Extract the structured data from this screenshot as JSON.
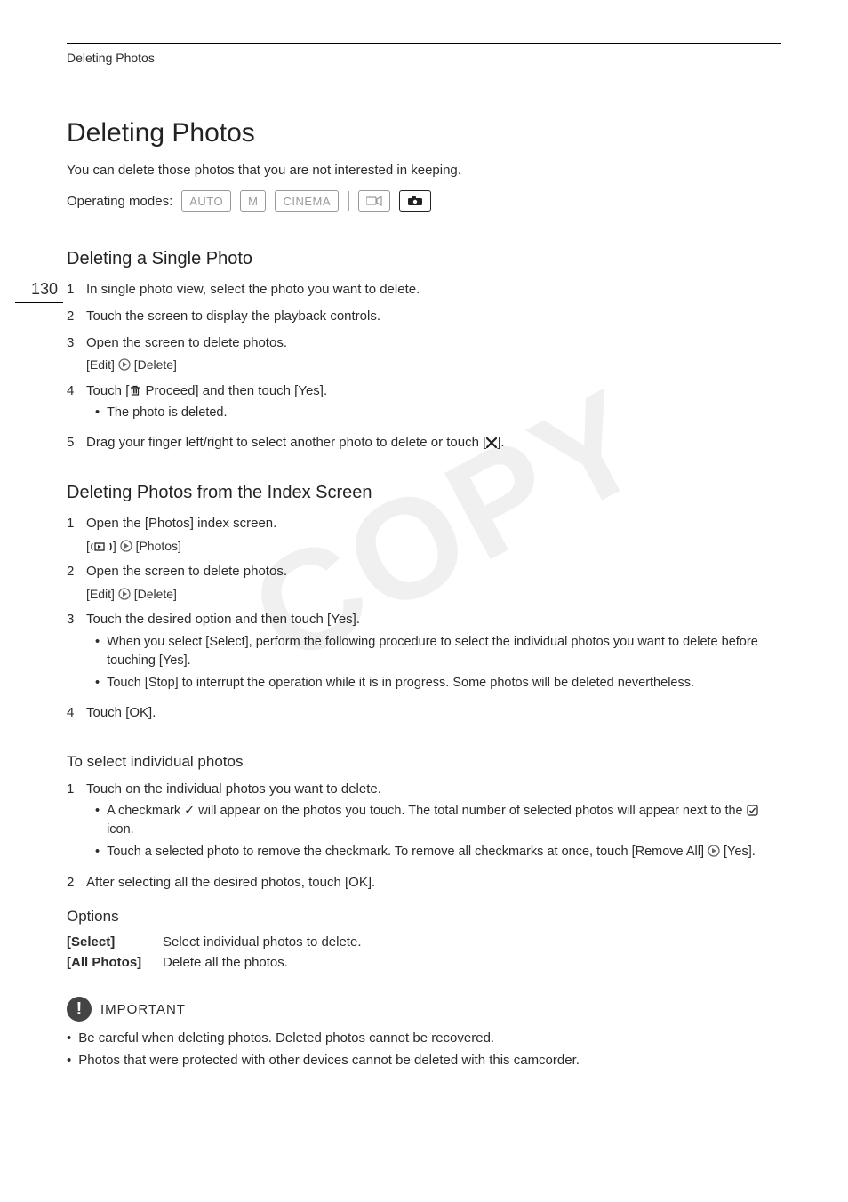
{
  "pageNumber": "130",
  "headerSmall": "Deleting Photos",
  "h1": "Deleting Photos",
  "intro": "You can delete those photos that you are not interested in keeping.",
  "modes": {
    "label": "Operating modes:",
    "items": [
      "AUTO",
      "M",
      "CINEMA"
    ]
  },
  "sectionA": {
    "title": "Deleting a Single Photo",
    "step1": "In single photo view, select the photo you want to delete.",
    "step2": "Touch the screen to display the playback controls.",
    "step3": "Open the screen to delete photos.",
    "step3_sub_left": "[Edit]",
    "step3_sub_right": "[Delete]",
    "step4_a": "Touch [",
    "step4_b": " Proceed] and then touch [Yes].",
    "step4_bullet": "The photo is deleted.",
    "step5_a": "Drag your finger left/right to select another photo to delete or touch [",
    "step5_b": "]."
  },
  "sectionB": {
    "title": "Deleting Photos from the Index Screen",
    "step1": "Open the [Photos] index screen.",
    "step1_sub_right": "[Photos]",
    "step2": "Open the screen to delete photos.",
    "step2_sub_left": "[Edit]",
    "step2_sub_right": "[Delete]",
    "step3": "Touch the desired option and then touch [Yes].",
    "step3_bullet1": "When you select [Select], perform the following procedure to select the individual photos you want to delete before touching [Yes].",
    "step3_bullet2": "Touch [Stop] to interrupt the operation while it is in progress. Some photos will be deleted nevertheless.",
    "step4": "Touch [OK]."
  },
  "sectionC": {
    "title": "To select individual photos",
    "step1": "Touch on the individual photos you want to delete.",
    "step1_b1_a": "A checkmark ✓ will appear on the photos you touch. The total number of selected photos will appear next to the ",
    "step1_b1_b": " icon.",
    "step1_b2_a": "Touch a selected photo to remove the checkmark. To remove all checkmarks at once, touch [Remove All] ",
    "step1_b2_b": " [Yes].",
    "step2": "After selecting all the desired photos, touch [OK]."
  },
  "optionsTitle": "Options",
  "option1_label": "[Select]",
  "option1_desc": "Select individual photos to delete.",
  "option2_label": "[All Photos]",
  "option2_desc": "Delete all the photos.",
  "importantLabel": "IMPORTANT",
  "note1": "Be careful when deleting photos. Deleted photos cannot be recovered.",
  "note2": "Photos that were protected with other devices cannot be deleted with this camcorder.",
  "watermark": "COPY"
}
